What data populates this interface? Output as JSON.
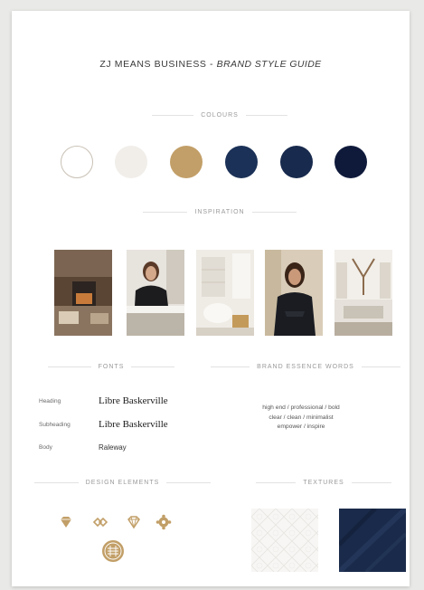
{
  "title": {
    "main": "ZJ MEANS BUSINESS - ",
    "emphasis": "BRAND STYLE GUIDE"
  },
  "sections": {
    "colours": "COLOURS",
    "inspiration": "INSPIRATION",
    "fonts": "FONTS",
    "brand_essence": "BRAND ESSENCE WORDS",
    "design_elements": "DESIGN ELEMENTS",
    "textures": "TEXTURES"
  },
  "colours": [
    "#ffffff",
    "#f1eeea",
    "#c29f68",
    "#1b3157",
    "#182a4d",
    "#0f1a3b"
  ],
  "fonts": [
    {
      "role": "Heading",
      "sample": "Libre Baskerville"
    },
    {
      "role": "Subheading",
      "sample": "Libre Baskerville"
    },
    {
      "role": "Body",
      "sample": "Raleway"
    }
  ],
  "brand_words": [
    "high end / professional / bold",
    "clear / clean / minimalist",
    "empower / inspire"
  ],
  "design_elements": [
    "diamond-icon",
    "links-icon",
    "gem-icon",
    "gear-icon",
    "emblem-icon"
  ],
  "accent": "#c29f68"
}
